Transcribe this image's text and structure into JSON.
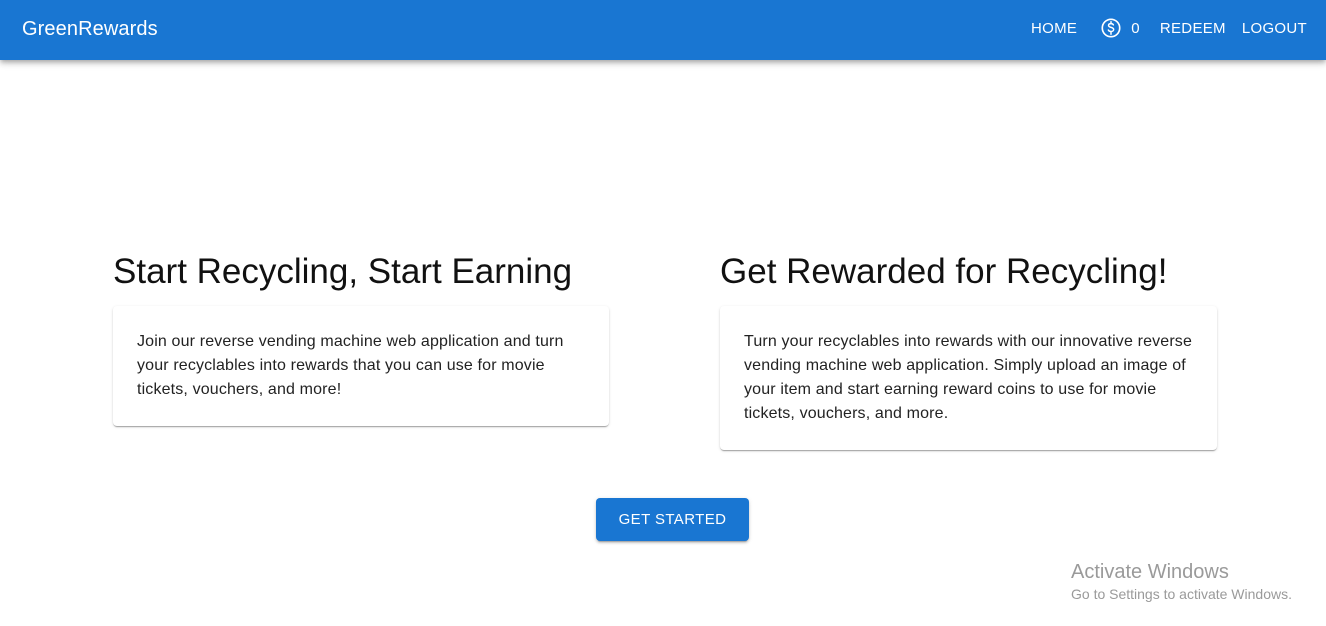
{
  "appbar": {
    "brand": "GreenRewards",
    "nav": {
      "home_label": "HOME",
      "coin_icon": "dollar-coin-icon",
      "coin_count": "0",
      "redeem_label": "REDEEM",
      "logout_label": "LOGOUT"
    },
    "color": "#1976d2"
  },
  "main": {
    "left": {
      "title": "Start Recycling, Start Earning",
      "body": "Join our reverse vending machine web application and turn your recyclables into rewards that you can use for movie tickets, vouchers, and more!"
    },
    "right": {
      "title": "Get Rewarded for Recycling!",
      "body": "Turn your recyclables into rewards with our innovative reverse vending machine web application. Simply upload an image of your item and start earning reward coins to use for movie tickets, vouchers, and more."
    },
    "cta_label": "GET STARTED"
  },
  "watermark": {
    "title": "Activate Windows",
    "subtitle": "Go to Settings to activate Windows."
  }
}
